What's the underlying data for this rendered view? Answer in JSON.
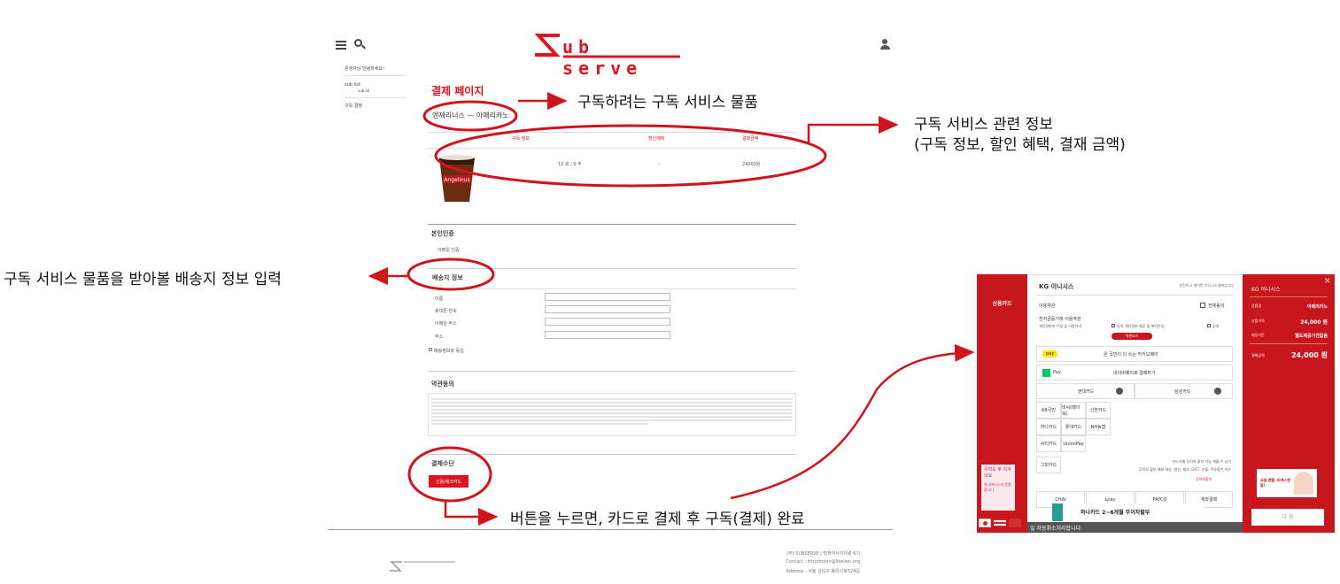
{
  "header": {
    "logo": "ub serve"
  },
  "sidebar": {
    "greeting": "온생자님 안녕하세요!",
    "items": [
      {
        "label": "sub list",
        "sub": "sub all"
      },
      {
        "label": "구독 결정"
      }
    ]
  },
  "main": {
    "page_title": "결제 페이지",
    "product_name": "엔제리너스 — 아메리카노",
    "table_headers": [
      "구독 정보",
      "할인혜택",
      "결제금액"
    ],
    "table_row": {
      "info": "12 회 / 6 주",
      "discount": "-",
      "amount": "24000원"
    },
    "identity_title": "본인인증",
    "identity_sub": "이메일 인증",
    "shipping_title": "배송지 정보",
    "shipping_fields": [
      "이름",
      "휴대폰 번호",
      "이메일 주소",
      "주소"
    ],
    "save_shipping": "배송정보와 동일",
    "terms_title": "약관동의",
    "payment_title": "결제수단",
    "pay_button": "신용/체크카드"
  },
  "footer": {
    "line1": "(주) SUBSERVE | 멋쟁이사자처럼 6기",
    "line2": "Contact : innotmoon@likelion.org",
    "line3": "Address : 서울 강남구 봉은사로524길"
  },
  "annotations": {
    "a1": "구독하려는 구독 서비스 물품",
    "a2_line1": "구독 서비스 관련 정보",
    "a2_line2": "(구독 정보, 할인 혜택, 결재 금액)",
    "a3": "구독 서비스 물품을 받아볼 배송지 정보 입력",
    "a4": "버튼을 누르면, 카드로 결제 후 구독(결제) 완료"
  },
  "payment_popup": {
    "left_label": "신용카드",
    "header_brand": "KG 이니시스",
    "header_right": "안전하고 편리한 이니시스결제입니다",
    "agree_label": "이용약관",
    "agree_all": "전체동의",
    "terms_title": "전자금융거래 이용약관",
    "terms_sub1": "개인정보의 수집 및 이용안내",
    "agree1": "동의",
    "terms_sub2": "개인정보 제공 및 위탁안내",
    "agree2": "동의",
    "view_terms": "약관보기",
    "kakaopay_badge": "pay",
    "kakaopay_text": "온 국민이 다 쓰는 카카오페이",
    "naverpay_badge": "Pay",
    "naverpay_text": "네이버페이로 결제하기",
    "card_hyundai": "현대카드",
    "card_samsung": "삼성카드",
    "cards": [
      "KB국민",
      "비씨(페이북)",
      "신한카드",
      "하나카드",
      "롯데카드",
      "NH농협",
      "씨티카드",
      "UnionPay",
      "그외카드"
    ],
    "installment_note1": "카드사별 무이자 할부 가능 개월 수 상이",
    "installment_note2": "무이자 할부 제외 대상: 법인, 체크, GIFT, 선불, 주유할인 카드",
    "installment_link": "무이자할부",
    "bottom_options": [
      "CHAI",
      "Lpay",
      "PAYCO",
      "계좌결제"
    ],
    "hana_promo": "하나카드 2~6개월 무이자할부",
    "ad_text1": "우리도 후 이겨내요",
    "ad_text2": "하나머니스가 응원합니다",
    "bar_text": "일 자동취소처리합니다.",
    "right_brand": "KG 이니시스",
    "summary": [
      {
        "label": "상품명",
        "value": "아메리카노"
      },
      {
        "label": "상품가격",
        "value": "24,000 원"
      },
      {
        "label": "제공기간",
        "value": "별도제공기간없음"
      }
    ],
    "total_label": "결제금액",
    "total_value": "24,000 원",
    "right_ad": "요즘 렌탈, 비에스렌탈!",
    "next_button": "다 음"
  },
  "colors": {
    "brand_red": "#e0141e",
    "popup_red": "#c8161d"
  }
}
